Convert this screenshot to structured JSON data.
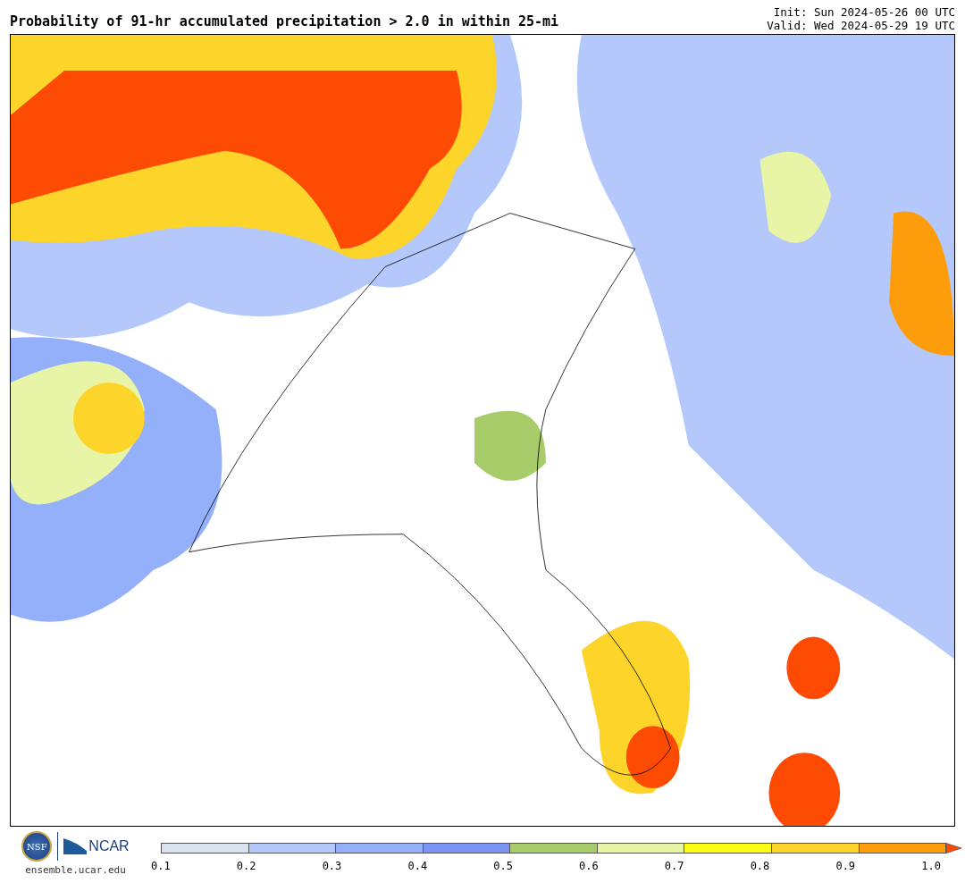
{
  "title": "Probability of 91-hr accumulated precipitation > 2.0 in within 25-mi",
  "init": "Init: Sun 2024-05-26 00 UTC",
  "valid": "Valid: Wed 2024-05-29 19 UTC",
  "logos": {
    "nsf": "NSF",
    "ncar": "NCAR",
    "url": "ensemble.ucar.edu"
  },
  "colorbar": {
    "bins": [
      {
        "color": "#d9e3ef"
      },
      {
        "color": "#b4c8fb"
      },
      {
        "color": "#95b0fb"
      },
      {
        "color": "#7b93f5"
      },
      {
        "color": "#a8cc6a"
      },
      {
        "color": "#e9f5a6"
      },
      {
        "color": "#fdfc17"
      },
      {
        "color": "#fdd42a"
      },
      {
        "color": "#fd9d0c"
      }
    ],
    "extend": {
      "color": "#fd4b04"
    },
    "ticks": [
      "0.1",
      "0.2",
      "0.3",
      "0.4",
      "0.5",
      "0.6",
      "0.7",
      "0.8",
      "0.9",
      "1.0"
    ]
  }
}
